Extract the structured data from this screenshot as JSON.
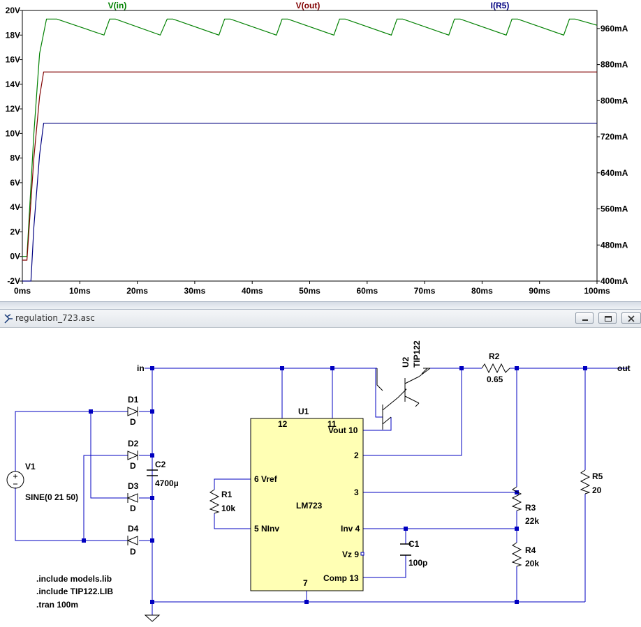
{
  "chart_data": {
    "type": "line",
    "title": "",
    "xlabel": "",
    "ylabel": "",
    "xlim": [
      0,
      100
    ],
    "ylim_left": [
      -2,
      20
    ],
    "ylim_right": [
      400,
      1000
    ],
    "x_ticks": [
      "0ms",
      "10ms",
      "20ms",
      "30ms",
      "40ms",
      "50ms",
      "60ms",
      "70ms",
      "80ms",
      "90ms",
      "100ms"
    ],
    "y_ticks_left": [
      "-2V",
      "0V",
      "2V",
      "4V",
      "6V",
      "8V",
      "10V",
      "12V",
      "14V",
      "16V",
      "18V",
      "20V"
    ],
    "y_ticks_right": [
      "400mA",
      "480mA",
      "560mA",
      "640mA",
      "720mA",
      "800mA",
      "880mA",
      "960mA"
    ],
    "series": [
      {
        "name": "V(in)",
        "color": "#008000",
        "axis": "left",
        "x": [
          0,
          0.8,
          2.0,
          3.0,
          4.2,
          6.0,
          14.2,
          15.2,
          16.2,
          24.0,
          25.2,
          26.2,
          34.2,
          35.2,
          36.2,
          44.2,
          45.2,
          46.2,
          54.2,
          55.2,
          56.2,
          64.2,
          65.2,
          66.2,
          74.2,
          75.2,
          76.2,
          84.2,
          85.2,
          86.2,
          94.2,
          95.2,
          96.2,
          100
        ],
        "y": [
          0,
          0,
          10,
          16.5,
          19.3,
          19.3,
          18.0,
          19.3,
          19.3,
          18.0,
          19.3,
          19.3,
          18.0,
          19.3,
          19.3,
          18.0,
          19.3,
          19.3,
          18.0,
          19.3,
          19.3,
          18.0,
          19.3,
          19.3,
          18.0,
          19.3,
          19.3,
          18.0,
          19.3,
          19.3,
          18.0,
          19.3,
          19.3,
          18.8
        ]
      },
      {
        "name": "V(out)",
        "color": "#800000",
        "axis": "left",
        "x": [
          0,
          0.8,
          2.0,
          3.0,
          3.7,
          100
        ],
        "y": [
          -0.3,
          -0.3,
          8,
          13,
          15,
          15
        ]
      },
      {
        "name": "I(R5)",
        "color": "#000080",
        "axis": "right",
        "x": [
          0,
          1.5,
          2.0,
          3.0,
          3.7,
          100
        ],
        "y": [
          400,
          400,
          520,
          680,
          750,
          750
        ]
      }
    ]
  },
  "window": {
    "title": "regulation_723.asc"
  },
  "schematic": {
    "net_in": "in",
    "net_out": "out",
    "u1_ref": "U1",
    "u1_part": "LM723",
    "u1_pins": {
      "p12": "12",
      "p11": "11",
      "vout": "Vout 10",
      "p2": "2",
      "p3": "3",
      "inv": "Inv 4",
      "vz": "Vz 9",
      "comp": "Comp 13",
      "p7": "7",
      "vref": "6 Vref",
      "ninv": "5 NInv"
    },
    "u2_ref": "U2",
    "u2_part": "TIP122",
    "r1": {
      "ref": "R1",
      "val": "10k"
    },
    "r2": {
      "ref": "R2",
      "val": "0.65"
    },
    "r3": {
      "ref": "R3",
      "val": "22k"
    },
    "r4": {
      "ref": "R4",
      "val": "20k"
    },
    "r5": {
      "ref": "R5",
      "val": "20"
    },
    "c1": {
      "ref": "C1",
      "val": "100p"
    },
    "c2": {
      "ref": "C2",
      "val": "4700µ"
    },
    "d1": {
      "ref": "D1",
      "val": "D"
    },
    "d2": {
      "ref": "D2",
      "val": "D"
    },
    "d3": {
      "ref": "D3",
      "val": "D"
    },
    "d4": {
      "ref": "D4",
      "val": "D"
    },
    "v1": {
      "ref": "V1",
      "val": "SINE(0 21 50)"
    },
    "directives": [
      ".include models.lib",
      ".include TIP122.LIB",
      ".tran 100m"
    ]
  }
}
